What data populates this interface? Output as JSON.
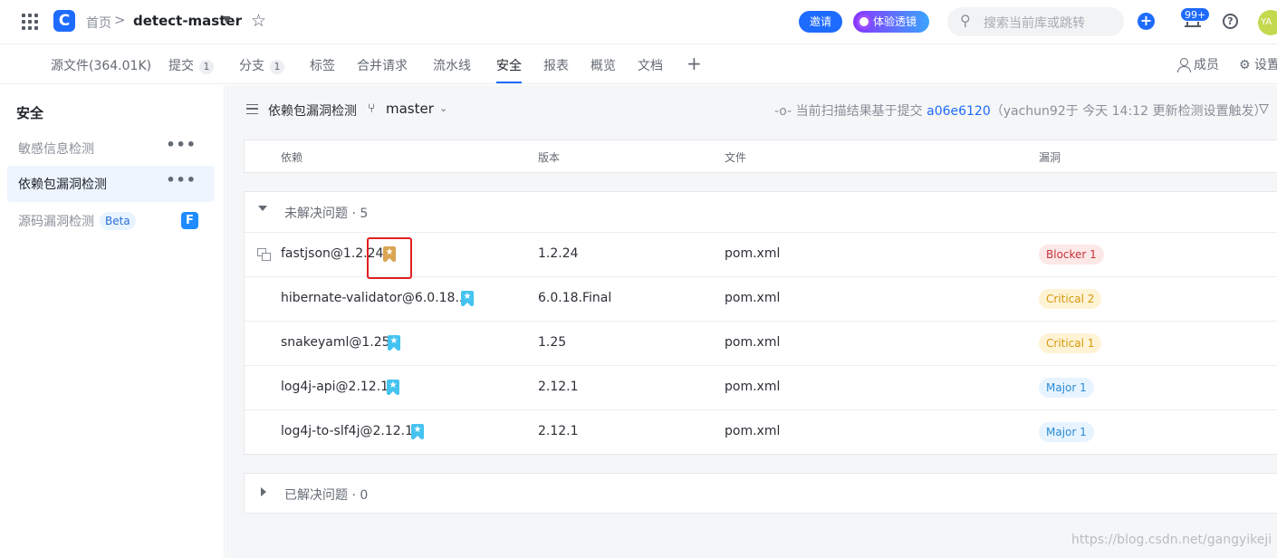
{
  "topbar": {
    "home": "首页",
    "separator": ">",
    "repo": "detect-master",
    "invite": "邀请",
    "lens": "体验透镜",
    "search_placeholder": "搜索当前库或跳转",
    "notifications": "99+",
    "avatar": "YA"
  },
  "tabs": [
    {
      "label": "源文件(364.01K)",
      "count": ""
    },
    {
      "label": "提交",
      "count": "1"
    },
    {
      "label": "分支",
      "count": "1"
    },
    {
      "label": "标签",
      "count": ""
    },
    {
      "label": "合并请求",
      "count": ""
    },
    {
      "label": "流水线",
      "count": ""
    },
    {
      "label": "安全",
      "count": "",
      "active": true
    },
    {
      "label": "报表",
      "count": ""
    },
    {
      "label": "概览",
      "count": ""
    },
    {
      "label": "文档",
      "count": ""
    }
  ],
  "tab_right": {
    "members": "成员",
    "settings": "设置"
  },
  "sidebar": {
    "title": "安全",
    "items": [
      {
        "label": "敏感信息检测",
        "more": "•••"
      },
      {
        "label": "依赖包漏洞检测",
        "more": "•••",
        "active": true
      },
      {
        "label": "源码漏洞检测",
        "badge": "Beta",
        "icon": "F"
      }
    ]
  },
  "main": {
    "title": "依赖包漏洞检测",
    "branch": "master",
    "scan_prefix": "当前扫描结果基于提交",
    "commit": "a06e6120",
    "scan_suffix": "（yachun92于 今天 14:12 更新检测设置触发）",
    "columns": [
      "依赖",
      "版本",
      "文件",
      "漏洞"
    ],
    "unresolved_label": "未解决问题 · 5",
    "resolved_label": "已解决问题 · 0",
    "rows": [
      {
        "dep": "fastjson@1.2.24",
        "version": "1.2.24",
        "file": "pom.xml",
        "severity": "Blocker 1",
        "level": "blocker",
        "bookmark_color": "#d9a552"
      },
      {
        "dep": "hibernate-validator@6.0.18...",
        "version": "6.0.18.Final",
        "file": "pom.xml",
        "severity": "Critical 2",
        "level": "critical",
        "bookmark_color": "#45c3f0"
      },
      {
        "dep": "snakeyaml@1.25",
        "version": "1.25",
        "file": "pom.xml",
        "severity": "Critical 1",
        "level": "critical",
        "bookmark_color": "#45c3f0"
      },
      {
        "dep": "log4j-api@2.12.1",
        "version": "2.12.1",
        "file": "pom.xml",
        "severity": "Major 1",
        "level": "major",
        "bookmark_color": "#45c3f0"
      },
      {
        "dep": "log4j-to-slf4j@2.12.1",
        "version": "2.12.1",
        "file": "pom.xml",
        "severity": "Major 1",
        "level": "major",
        "bookmark_color": "#45c3f0"
      }
    ]
  },
  "watermark": "https://blog.csdn.net/gangyikeji"
}
